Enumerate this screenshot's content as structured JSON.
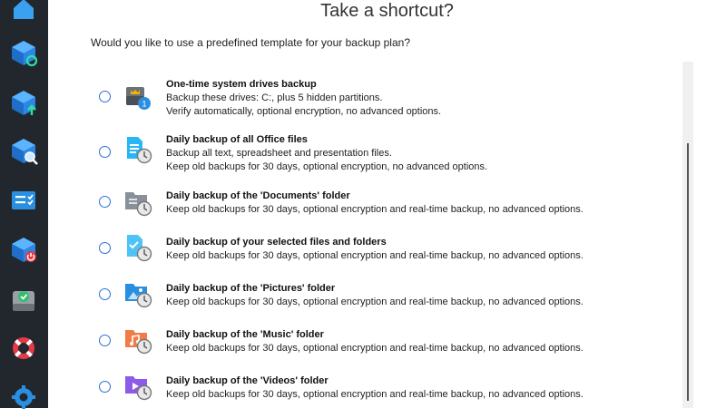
{
  "sidebar": {
    "items": [
      {
        "name": "home-icon"
      },
      {
        "name": "backup-restore-icon"
      },
      {
        "name": "backup-upload-icon"
      },
      {
        "name": "backup-search-icon"
      },
      {
        "name": "task-list-icon"
      },
      {
        "name": "backup-power-icon"
      },
      {
        "name": "drive-check-icon"
      },
      {
        "name": "lifebuoy-icon"
      },
      {
        "name": "gear-icon"
      }
    ]
  },
  "header": {
    "title": "Take a shortcut?"
  },
  "question": "Would you like to use a predefined template for your backup plan?",
  "options": [
    {
      "title": "One-time system drives backup",
      "line1": "Backup these drives: C:, plus 5 hidden partitions.",
      "line2": "Verify automatically, optional encryption, no advanced options.",
      "icon": "system-drive-icon",
      "badge": "1"
    },
    {
      "title": "Daily backup of all Office files",
      "line1": "Backup all text, spreadsheet and presentation files.",
      "line2": "Keep old backups for 30 days, optional encryption, no advanced options.",
      "icon": "office-file-clock-icon"
    },
    {
      "title": "Daily backup of the 'Documents' folder",
      "line1": "Keep old backups for 30 days, optional encryption and real-time backup, no advanced options.",
      "icon": "documents-folder-clock-icon"
    },
    {
      "title": "Daily backup of your selected files and folders",
      "line1": "Keep old backups for 30 days, optional encryption and real-time backup, no advanced options.",
      "icon": "selected-files-clock-icon"
    },
    {
      "title": "Daily backup of the 'Pictures' folder",
      "line1": "Keep old backups for 30 days, optional encryption and real-time backup, no advanced options.",
      "icon": "pictures-folder-clock-icon"
    },
    {
      "title": "Daily backup of the 'Music' folder",
      "line1": "Keep old backups for 30 days, optional encryption and real-time backup, no advanced options.",
      "icon": "music-folder-clock-icon"
    },
    {
      "title": "Daily backup of the 'Videos' folder",
      "line1": "Keep old backups for 30 days, optional encryption and real-time backup, no advanced options.",
      "icon": "videos-folder-clock-icon"
    }
  ],
  "colors": {
    "sidebar_bg": "#22272e",
    "accent": "#2b6fd6",
    "icon_blue": "#2a8fe0"
  }
}
